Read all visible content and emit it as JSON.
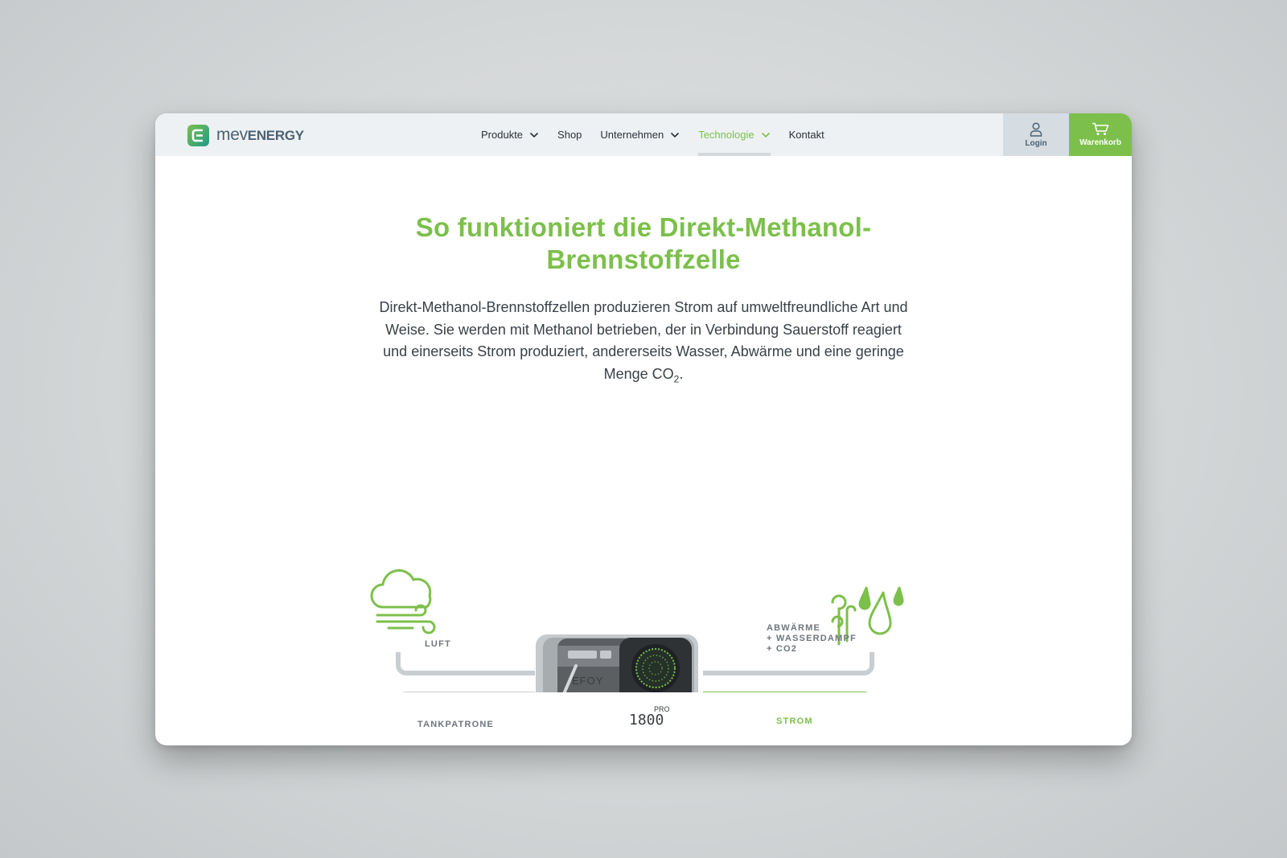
{
  "header": {
    "logo": {
      "thin": "mev",
      "bold": "ENERGY"
    },
    "nav": [
      {
        "label": "Produkte",
        "dropdown": true
      },
      {
        "label": "Shop",
        "dropdown": false
      },
      {
        "label": "Unternehmen",
        "dropdown": true
      },
      {
        "label": "Technologie",
        "dropdown": true,
        "active": true
      },
      {
        "label": "Kontakt",
        "dropdown": false
      }
    ],
    "login_label": "Login",
    "cart_label": "Warenkorb"
  },
  "main": {
    "heading_line1": "So funktioniert die Direkt-Methanol-",
    "heading_line2": "Brennstoffzelle",
    "intro_main": "Direkt-Methanol-Brennstoffzellen produzieren Strom auf umweltfreundliche Art und Weise. Sie werden mit Methanol betrieben, der in Verbindung Sauerstoff reagiert und einerseits Strom produziert, andererseits Wasser, Abwärme und eine geringe Menge CO",
    "intro_sub": "2",
    "intro_end": "."
  },
  "diagram": {
    "label_luft": "LUFT",
    "label_tankpatrone": "TANKPATRONE",
    "label_abwaerme_1": "ABWÄRME",
    "label_abwaerme_2": "+ WASSERDAMPF",
    "label_abwaerme_3": "+ CO2",
    "label_strom": "STROM",
    "device_brand": "EFOY",
    "device_model_1": "PRO",
    "device_model_2": "1800"
  },
  "colors": {
    "accent": "#7cc04b",
    "header_bg": "#eef1f3",
    "login_bg": "#d5dde2",
    "pipe_gray": "#c9ced3",
    "text": "#3a4047"
  },
  "icons": [
    "logo-mark-icon",
    "chevron-down-icon",
    "user-icon",
    "cart-icon",
    "cloud-wind-icon",
    "cartridge-icon",
    "heat-icon",
    "water-drops-icon",
    "battery-icon"
  ]
}
